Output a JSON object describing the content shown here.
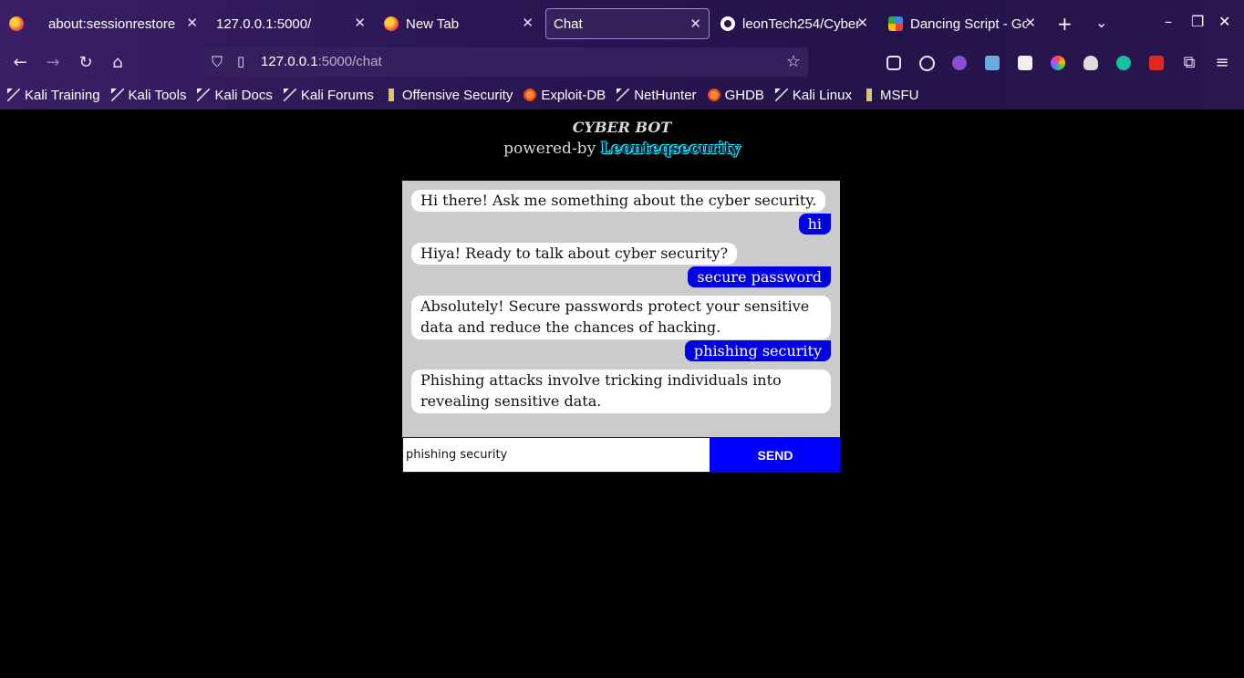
{
  "browser": {
    "tabs": [
      {
        "title": "about:sessionrestore",
        "icon": "firefox-icon"
      },
      {
        "title": "127.0.0.1:5000/",
        "icon": "none"
      },
      {
        "title": "New Tab",
        "icon": "firefox-icon"
      },
      {
        "title": "Chat",
        "icon": "none",
        "active": true
      },
      {
        "title": "leonTech254/Cyber",
        "icon": "github-icon"
      },
      {
        "title": "Dancing Script - Go",
        "icon": "google-fonts-icon"
      }
    ],
    "url": {
      "host": "127.0.0.1",
      "path": ":5000/chat"
    },
    "bookmarks": [
      {
        "label": "Kali Training",
        "icon": "kali-dragon-icon"
      },
      {
        "label": "Kali Tools",
        "icon": "kali-dragon-icon"
      },
      {
        "label": "Kali Docs",
        "icon": "kali-dragon-icon"
      },
      {
        "label": "Kali Forums",
        "icon": "kali-dragon-icon"
      },
      {
        "label": "Offensive Security",
        "icon": "offsec-icon"
      },
      {
        "label": "Exploit-DB",
        "icon": "exploitdb-icon"
      },
      {
        "label": "NetHunter",
        "icon": "kali-dragon-icon"
      },
      {
        "label": "GHDB",
        "icon": "exploitdb-icon"
      },
      {
        "label": "Kali Linux",
        "icon": "kali-dragon-icon"
      },
      {
        "label": "MSFU",
        "icon": "offsec-icon"
      }
    ],
    "colors": {
      "chrome": "#2a1652",
      "accent": "#9e86d6"
    }
  },
  "app": {
    "title": "CYBER BOT",
    "subtitle_prefix": "powered-by ",
    "brand": "Leonteqsecurity",
    "messages": [
      {
        "role": "bot",
        "text": "Hi there! Ask me something about the cyber security."
      },
      {
        "role": "user",
        "text": "hi"
      },
      {
        "role": "bot",
        "text": "Hiya! Ready to talk about cyber security?"
      },
      {
        "role": "user",
        "text": "secure password"
      },
      {
        "role": "bot",
        "text": "Absolutely! Secure passwords protect your sensitive data and reduce the chances of hacking."
      },
      {
        "role": "user",
        "text": "phishing security"
      },
      {
        "role": "bot",
        "text": "Phishing attacks involve tricking individuals into revealing sensitive data."
      }
    ],
    "input_value": "phishing security",
    "send_label": "SEND",
    "colors": {
      "user_bubble": "#0000e5",
      "bot_bubble": "#ffffff",
      "chat_bg": "#cbcbcb",
      "send_button": "#0000ff"
    }
  }
}
